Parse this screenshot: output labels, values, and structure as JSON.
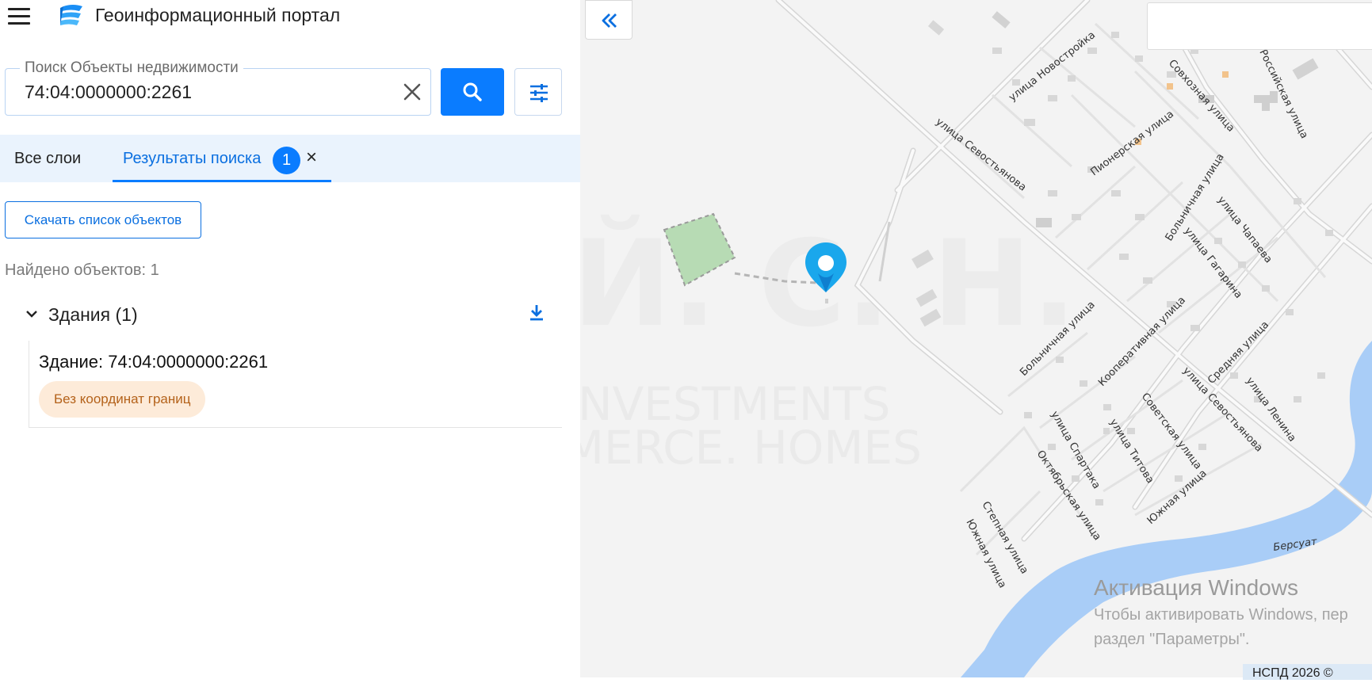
{
  "app": {
    "title": "Геоинформационный портал"
  },
  "search": {
    "legend": "Поиск Объекты недвижимости",
    "value": "74:04:0000000:2261"
  },
  "tabs": {
    "all_layers": "Все слои",
    "results": "Результаты поиска",
    "results_count": "1"
  },
  "results": {
    "download_button": "Скачать список объектов",
    "found_text": "Найдено объектов: 1",
    "group_title": "Здания (1)",
    "item_title": "Здание: 74:04:0000000:2261",
    "item_badge": "Без координат границ"
  },
  "map": {
    "streets": [
      "улица Новостройка",
      "Совхозная улица",
      "Российская улица",
      "улица Севостьянова",
      "Пионерская улица",
      "Больничная улица",
      "улица Чапаева",
      "Больничная улица",
      "улица Гагарина",
      "Кооперативная улица",
      "Средняя улица",
      "улица Севостьянова",
      "улица Ленина",
      "Советская улица",
      "улица Спартака",
      "улица Титова",
      "Октябрьская улица",
      "Южная улица",
      "Степная улица",
      "Южная улица"
    ],
    "river": "Берсуат",
    "watermark_1": "INVESTMENTS",
    "watermark_2": "MERCE. HOMES",
    "accent": "#0a7cff",
    "marker_color": "#1aa7ec"
  },
  "windows_notice": {
    "title": "Активация Windows",
    "line1": "Чтобы активировать Windows, пер",
    "line2": "раздел \"Параметры\"."
  },
  "attribution": "НСПД 2026 ©"
}
